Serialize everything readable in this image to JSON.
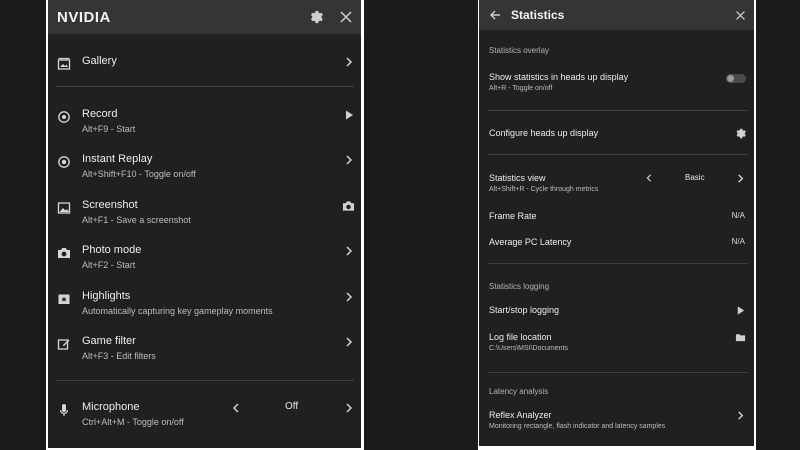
{
  "left": {
    "title": "NVIDIA",
    "items": [
      {
        "title": "Gallery",
        "sub": ""
      },
      {
        "title": "Record",
        "sub": "Alt+F9 - Start"
      },
      {
        "title": "Instant Replay",
        "sub": "Alt+Shift+F10 - Toggle on/off"
      },
      {
        "title": "Screenshot",
        "sub": "Alt+F1 - Save a screenshot"
      },
      {
        "title": "Photo mode",
        "sub": "Alt+F2 - Start"
      },
      {
        "title": "Highlights",
        "sub": "Automatically capturing key gameplay moments"
      },
      {
        "title": "Game filter",
        "sub": "Alt+F3 - Edit filters"
      },
      {
        "title": "Microphone",
        "sub": "Ctrl+Alt+M - Toggle on/off",
        "value": "Off"
      }
    ]
  },
  "right": {
    "title": "Statistics",
    "sections": {
      "overlay": "Statistics overlay",
      "logging": "Statistics logging",
      "latency": "Latency analysis"
    },
    "items": {
      "show_stats": {
        "title": "Show statistics in heads up display",
        "sub": "Alt+R - Toggle on/off",
        "enabled": false
      },
      "configure": {
        "title": "Configure heads up display"
      },
      "stats_view": {
        "title": "Statistics view",
        "sub": "Alt+Shift+R - Cycle through metrics",
        "value": "Basic"
      },
      "frame_rate": {
        "title": "Frame Rate",
        "value": "N/A"
      },
      "latency": {
        "title": "Average PC Latency",
        "value": "N/A"
      },
      "start_stop": {
        "title": "Start/stop logging"
      },
      "log_location": {
        "title": "Log file location",
        "sub": "C:\\Users\\MSI\\Documents"
      },
      "reflex": {
        "title": "Reflex Analyzer",
        "sub": "Monitoring rectangle, flash indicator and latency samples"
      }
    }
  }
}
